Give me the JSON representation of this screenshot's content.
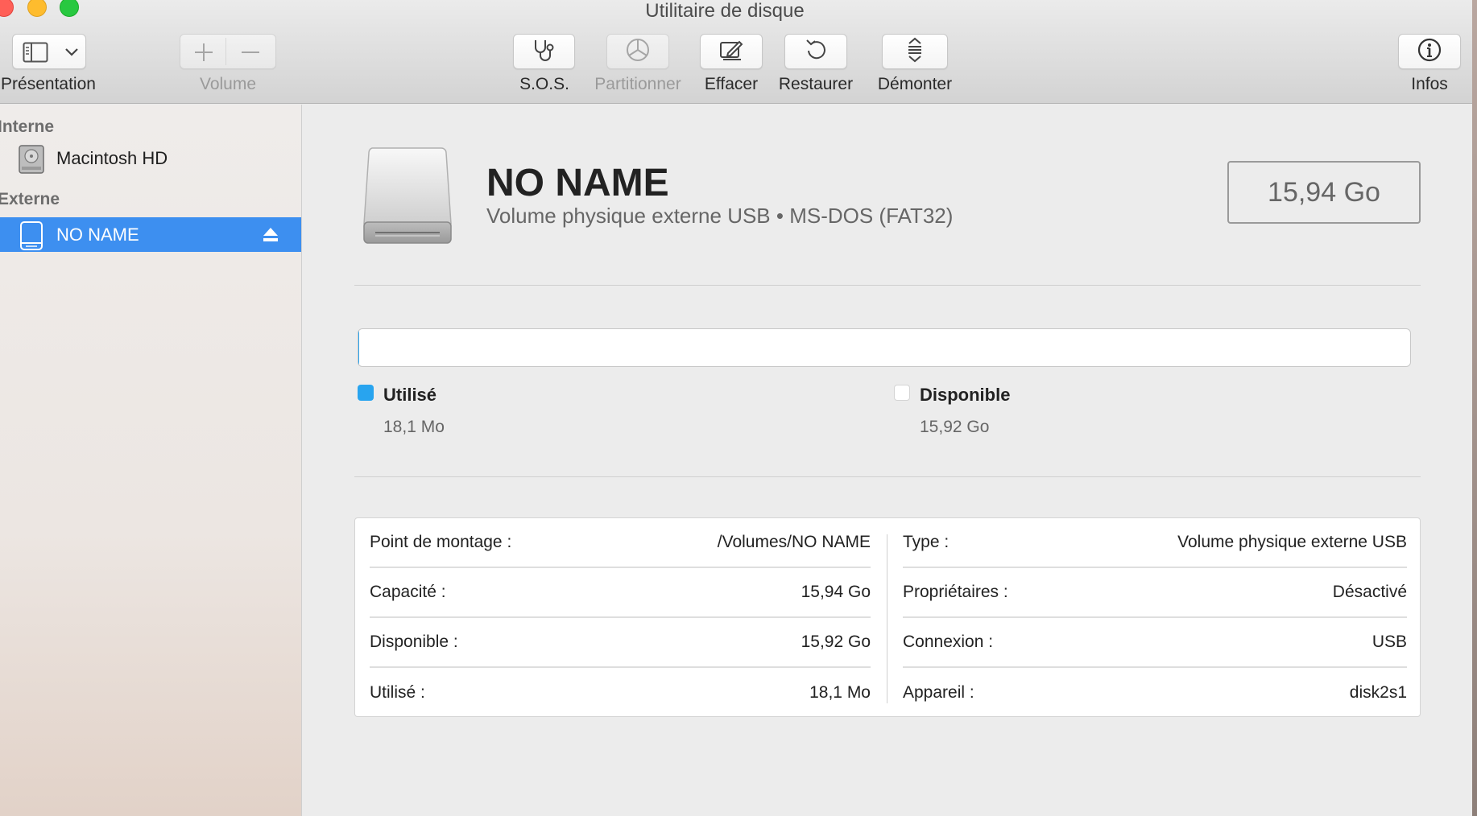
{
  "window": {
    "title": "Utilitaire de disque"
  },
  "toolbar": {
    "presentation_label": "Présentation",
    "volume_label": "Volume",
    "sos_label": "S.O.S.",
    "partition_label": "Partitionner",
    "erase_label": "Effacer",
    "restore_label": "Restaurer",
    "unmount_label": "Démonter",
    "info_label": "Infos"
  },
  "sidebar": {
    "sections": [
      {
        "label": "Interne",
        "items": [
          {
            "label": "Macintosh HD",
            "icon": "internal-disk-icon"
          }
        ]
      },
      {
        "label": "Externe",
        "items": [
          {
            "label": "NO NAME",
            "icon": "external-disk-icon",
            "selected": true
          }
        ]
      }
    ]
  },
  "volume": {
    "name": "NO NAME",
    "description": "Volume physique externe USB • MS-DOS (FAT32)",
    "size": "15,94 Go"
  },
  "usage": {
    "used_fraction": 0.0011,
    "used_color": "#28a4ef",
    "free_color": "#ffffff",
    "used_title": "Utilisé",
    "used_value": "18,1 Mo",
    "free_title": "Disponible",
    "free_value": "15,92 Go"
  },
  "info": {
    "left": [
      {
        "label": "Point de montage :",
        "value": "/Volumes/NO NAME"
      },
      {
        "label": "Capacité :",
        "value": "15,94 Go"
      },
      {
        "label": "Disponible :",
        "value": "15,92 Go"
      },
      {
        "label": "Utilisé :",
        "value": "18,1 Mo"
      }
    ],
    "right": [
      {
        "label": "Type :",
        "value": "Volume physique externe USB"
      },
      {
        "label": "Propriétaires :",
        "value": "Désactivé"
      },
      {
        "label": "Connexion :",
        "value": "USB"
      },
      {
        "label": "Appareil :",
        "value": "disk2s1"
      }
    ]
  }
}
